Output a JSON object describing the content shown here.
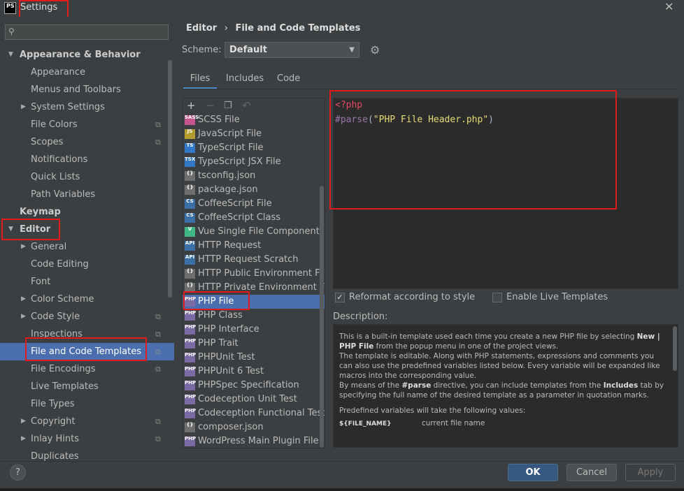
{
  "window": {
    "title": "Settings",
    "app_icon_text": "PS",
    "close_glyph": "✕"
  },
  "search": {
    "placeholder": ""
  },
  "tree": [
    {
      "label": "Appearance & Behavior",
      "level": 0,
      "bold": true,
      "expanded": true
    },
    {
      "label": "Appearance",
      "level": 1
    },
    {
      "label": "Menus and Toolbars",
      "level": 1
    },
    {
      "label": "System Settings",
      "level": 1,
      "collapsed": true
    },
    {
      "label": "File Colors",
      "level": 1,
      "copy": true
    },
    {
      "label": "Scopes",
      "level": 1,
      "copy": true
    },
    {
      "label": "Notifications",
      "level": 1
    },
    {
      "label": "Quick Lists",
      "level": 1
    },
    {
      "label": "Path Variables",
      "level": 1
    },
    {
      "label": "Keymap",
      "level": 0,
      "bold": true
    },
    {
      "label": "Editor",
      "level": 0,
      "bold": true,
      "expanded": true
    },
    {
      "label": "General",
      "level": 1,
      "collapsed": true
    },
    {
      "label": "Code Editing",
      "level": 1
    },
    {
      "label": "Font",
      "level": 1
    },
    {
      "label": "Color Scheme",
      "level": 1,
      "collapsed": true
    },
    {
      "label": "Code Style",
      "level": 1,
      "collapsed": true,
      "copy": true
    },
    {
      "label": "Inspections",
      "level": 1,
      "copy": true
    },
    {
      "label": "File and Code Templates",
      "level": 1,
      "copy": true,
      "selected": true
    },
    {
      "label": "File Encodings",
      "level": 1,
      "copy": true
    },
    {
      "label": "Live Templates",
      "level": 1
    },
    {
      "label": "File Types",
      "level": 1
    },
    {
      "label": "Copyright",
      "level": 1,
      "collapsed": true,
      "copy": true
    },
    {
      "label": "Inlay Hints",
      "level": 1,
      "collapsed": true,
      "copy": true
    },
    {
      "label": "Duplicates",
      "level": 1
    }
  ],
  "breadcrumb": {
    "part1": "Editor",
    "separator": "›",
    "part2": "File and Code Templates"
  },
  "scheme": {
    "label": "Scheme:",
    "value": "Default"
  },
  "tabs": [
    "Files",
    "Includes",
    "Code"
  ],
  "toolbar": {
    "add": "+",
    "remove": "−",
    "copy": "❐",
    "reset": "↶"
  },
  "files": [
    {
      "name": "SCSS File",
      "icon": "SASS",
      "color": "#c6538c"
    },
    {
      "name": "JavaScript File",
      "icon": "JS",
      "color": "#b59b2b"
    },
    {
      "name": "TypeScript File",
      "icon": "TS",
      "color": "#3178c6"
    },
    {
      "name": "TypeScript JSX File",
      "icon": "TSX",
      "color": "#3178c6"
    },
    {
      "name": "tsconfig.json",
      "icon": "{}",
      "color": "#6e6e6e"
    },
    {
      "name": "package.json",
      "icon": "{}",
      "color": "#6e6e6e"
    },
    {
      "name": "CoffeeScript File",
      "icon": "CS",
      "color": "#3a6ea5"
    },
    {
      "name": "CoffeeScript Class",
      "icon": "CS",
      "color": "#3a6ea5"
    },
    {
      "name": "Vue Single File Component",
      "icon": "V",
      "color": "#41b883"
    },
    {
      "name": "HTTP Request",
      "icon": "API",
      "color": "#3a6ea5"
    },
    {
      "name": "HTTP Request Scratch",
      "icon": "API",
      "color": "#3a6ea5"
    },
    {
      "name": "HTTP Public Environment File",
      "icon": "{}",
      "color": "#6e6e6e"
    },
    {
      "name": "HTTP Private Environment File",
      "icon": "{}",
      "color": "#6e6e6e"
    },
    {
      "name": "PHP File",
      "icon": "PHP",
      "color": "#7a6aa5",
      "selected": true
    },
    {
      "name": "PHP Class",
      "icon": "PHP",
      "color": "#7a6aa5"
    },
    {
      "name": "PHP Interface",
      "icon": "PHP",
      "color": "#7a6aa5"
    },
    {
      "name": "PHP Trait",
      "icon": "PHP",
      "color": "#7a6aa5"
    },
    {
      "name": "PHPUnit Test",
      "icon": "PHP",
      "color": "#7a6aa5"
    },
    {
      "name": "PHPUnit 6 Test",
      "icon": "PHP",
      "color": "#7a6aa5"
    },
    {
      "name": "PHPSpec Specification",
      "icon": "PHP",
      "color": "#7a6aa5"
    },
    {
      "name": "Codeception Unit Test",
      "icon": "PHP",
      "color": "#7a6aa5"
    },
    {
      "name": "Codeception Functional Test",
      "icon": "PHP",
      "color": "#7a6aa5"
    },
    {
      "name": "composer.json",
      "icon": "{}",
      "color": "#6e6e6e"
    },
    {
      "name": "WordPress Main Plugin File",
      "icon": "PHP",
      "color": "#7a6aa5"
    }
  ],
  "editor": {
    "line1": "<?php",
    "line2_kw": "#parse",
    "line2_open": "(",
    "line2_str": "\"PHP File Header.php\"",
    "line2_close": ")"
  },
  "options": {
    "reformat": "Reformat according to style",
    "reformat_checked": true,
    "live": "Enable Live Templates",
    "live_checked": false
  },
  "description": {
    "label": "Description:",
    "p1a": "This is a built-in template used each time you create a new PHP file by selecting",
    "p1b": "New | PHP File",
    "p1c": " from the popup menu in one of the project views.",
    "p2": "The template is editable. Along with PHP statements, expressions and comments you can also use the predefined variables listed below. Every variable will be expanded like macros into the corresponding value.",
    "p3a": "By means of the ",
    "p3b": "#parse",
    "p3c": " directive, you can include templates from the ",
    "p3d": "Includes",
    "p3e": " tab by specifying the full name of the desired template as a parameter in quotation marks.",
    "p4": "Predefined variables will take the following values:",
    "var_name": "${FILE_NAME}",
    "var_desc": "current file name"
  },
  "footer": {
    "help": "?",
    "ok": "OK",
    "cancel": "Cancel",
    "apply": "Apply"
  }
}
